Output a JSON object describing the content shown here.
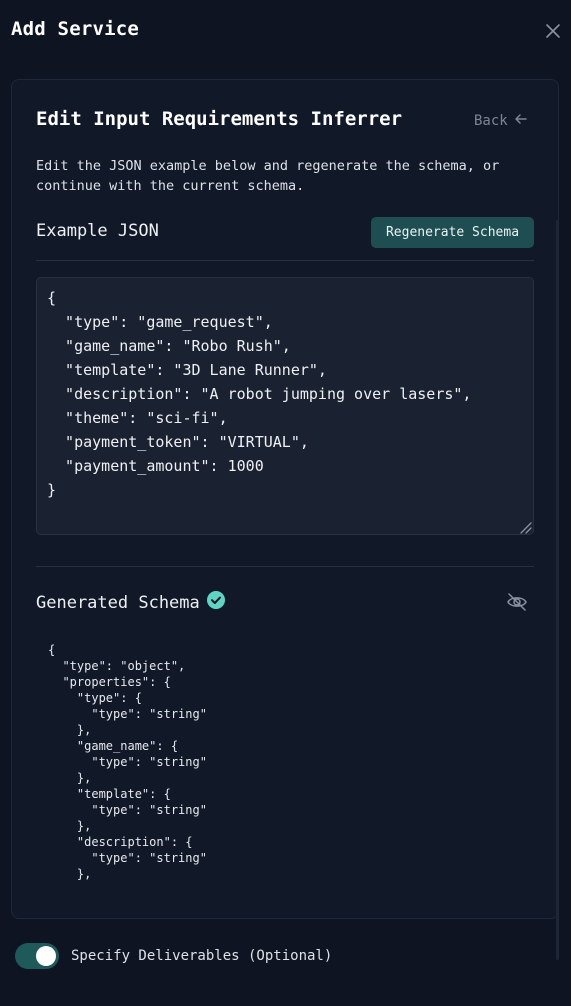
{
  "dialog": {
    "title": "Add Service"
  },
  "panel": {
    "title": "Edit Input Requirements Inferrer",
    "back_label": "Back",
    "description": "Edit the JSON example below and regenerate the schema, or continue with the current schema."
  },
  "example": {
    "label": "Example JSON",
    "regenerate_label": "Regenerate Schema",
    "json": "{\n  \"type\": \"game_request\",\n  \"game_name\": \"Robo Rush\",\n  \"template\": \"3D Lane Runner\",\n  \"description\": \"A robot jumping over lasers\",\n  \"theme\": \"sci-fi\",\n  \"payment_token\": \"VIRTUAL\",\n  \"payment_amount\": 1000\n}"
  },
  "schema": {
    "label": "Generated Schema",
    "code": "{\n  \"type\": \"object\",\n  \"properties\": {\n    \"type\": {\n      \"type\": \"string\"\n    },\n    \"game_name\": {\n      \"type\": \"string\"\n    },\n    \"template\": {\n      \"type\": \"string\"\n    },\n    \"description\": {\n      \"type\": \"string\"\n    },"
  },
  "deliverables": {
    "label": "Specify Deliverables (Optional)",
    "enabled": true
  },
  "icons": {
    "close": "close-icon",
    "back": "arrow-left-icon",
    "check": "check-circle-icon",
    "hide": "eye-off-icon"
  },
  "colors": {
    "accent": "#1f4e52",
    "check": "#5fd4c4",
    "background": "#0e1422",
    "panel": "#111828"
  }
}
